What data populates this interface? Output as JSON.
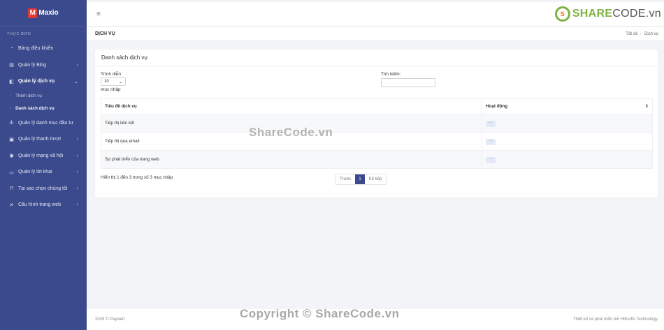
{
  "sidebar": {
    "logo_letter": "M",
    "logo_text": "Maxio",
    "heading": "THỰC ĐƠN",
    "items": [
      {
        "label": "Bảng điều khiển",
        "icon": "dashboard-icon",
        "glyph": "◔",
        "arrow": ""
      },
      {
        "label": "Quản lý Blog",
        "icon": "blog-icon",
        "glyph": "▤",
        "arrow": "›"
      },
      {
        "label": "Quản lý dịch vụ",
        "icon": "services-icon",
        "glyph": "◧",
        "arrow": "⌄"
      }
    ],
    "sub_items": [
      {
        "label": "Thêm dịch vụ",
        "dash": "-"
      },
      {
        "label": "Danh sách dịch vụ",
        "dash": "-"
      }
    ],
    "items_after": [
      {
        "label": "Quản lý danh mục đầu tư",
        "icon": "chart-icon",
        "glyph": "ılı",
        "arrow": ""
      },
      {
        "label": "Quản lý thanh trượt",
        "icon": "image-icon",
        "glyph": "▣",
        "arrow": "›"
      },
      {
        "label": "Quản lý mạng xã hội",
        "icon": "globe-icon",
        "glyph": "◉",
        "arrow": "›"
      },
      {
        "label": "Quản lý lời khai",
        "icon": "comment-icon",
        "glyph": "▭",
        "arrow": "›"
      },
      {
        "label": "Tại sao chọn chúng tôi",
        "icon": "lock-icon",
        "glyph": "⊓",
        "arrow": "›"
      },
      {
        "label": "Cấu hình trang web",
        "icon": "tools-icon",
        "glyph": "✕",
        "arrow": "›"
      }
    ]
  },
  "topbar": {
    "menu_icon": "≡",
    "brand_badge": "S",
    "brand_share": "SHARE",
    "brand_code": "CODE.vn"
  },
  "breadcrumb": {
    "title": "DỊCH VỤ",
    "root": "Tất cả",
    "sep": "›",
    "current": "Dịch vụ"
  },
  "card": {
    "title": "Danh sách dịch vụ",
    "length_label": "Trình diễn",
    "length_value": "10",
    "length_suffix": "mục nhập",
    "search_label": "Tìm kiếm:",
    "columns": [
      "Tiêu đề dịch vụ",
      "Hoạt động"
    ],
    "sort_glyph": "⇕",
    "rows": [
      {
        "title": "Tiếp thị liên kết",
        "action": "···"
      },
      {
        "title": "Tiếp thị qua email",
        "action": "···"
      },
      {
        "title": "Sự phát triển của trang web",
        "action": "···"
      }
    ],
    "info": "Hiển thị 1 đến 3 trong số 3 mục nhập",
    "pager": {
      "prev": "Trước",
      "current": "1",
      "next": "Kế tiếp"
    }
  },
  "footer": {
    "left": "2025 © Paywell.",
    "right": "Thiết kế và phát triển bởi Hillsofts Technology."
  },
  "watermarks": {
    "center": "ShareCode.vn",
    "bottom": "Copyright © ShareCode.vn"
  }
}
